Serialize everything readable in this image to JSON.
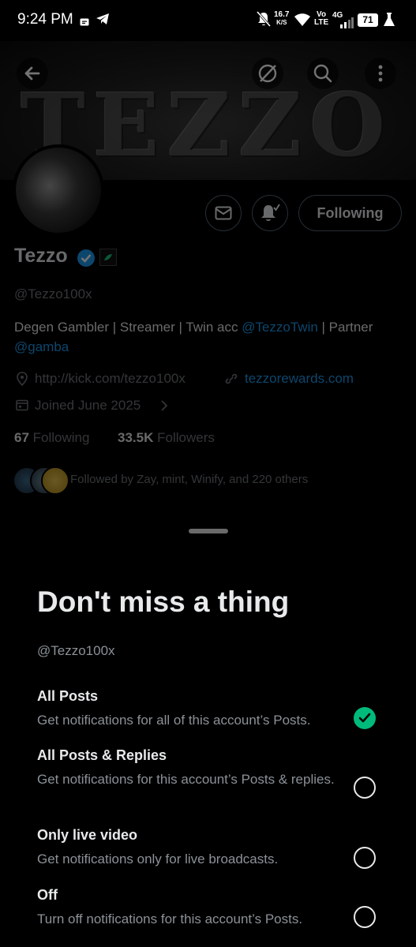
{
  "status_bar": {
    "time": "9:24 PM",
    "net_speed_value": "16.7",
    "net_speed_unit": "K/S",
    "volte_top": "Vo",
    "volte_bottom": "LTE",
    "network": "4G",
    "battery": "71"
  },
  "banner": {
    "text": "TEZZO"
  },
  "profile": {
    "display_name": "Tezzo",
    "handle": "@Tezzo100x",
    "bio_part1": "Degen Gambler | Streamer | Twin acc ",
    "bio_mention1": "@TezzoTwin",
    "bio_part2": " | Partner ",
    "bio_mention2": "@gamba",
    "website": "http://kick.com/tezzo100x",
    "link": "tezzorewards.com",
    "joined": "Joined June 2025",
    "following_count": "67",
    "following_label": "Following",
    "followers_count": "33.5K",
    "followers_label": "Followers",
    "followed_by": "Followed by Zay, mint, Winify, and 220 others",
    "following_button": "Following"
  },
  "sheet": {
    "title": "Don't miss a thing",
    "handle": "@Tezzo100x",
    "options": [
      {
        "title": "All Posts",
        "desc": "Get notifications for all of this account’s Posts.",
        "selected": true
      },
      {
        "title": "All Posts & Replies",
        "desc": "Get notifications for this account’s Posts & replies.",
        "selected": false
      },
      {
        "title": "Only live video",
        "desc": "Get notifications only for live broadcasts.",
        "selected": false
      },
      {
        "title": "Off",
        "desc": "Turn off notifications for this account’s Posts.",
        "selected": false
      }
    ]
  },
  "colors": {
    "accent": "#1d9bf0",
    "check": "#00ba7c",
    "muted": "#71767b"
  }
}
